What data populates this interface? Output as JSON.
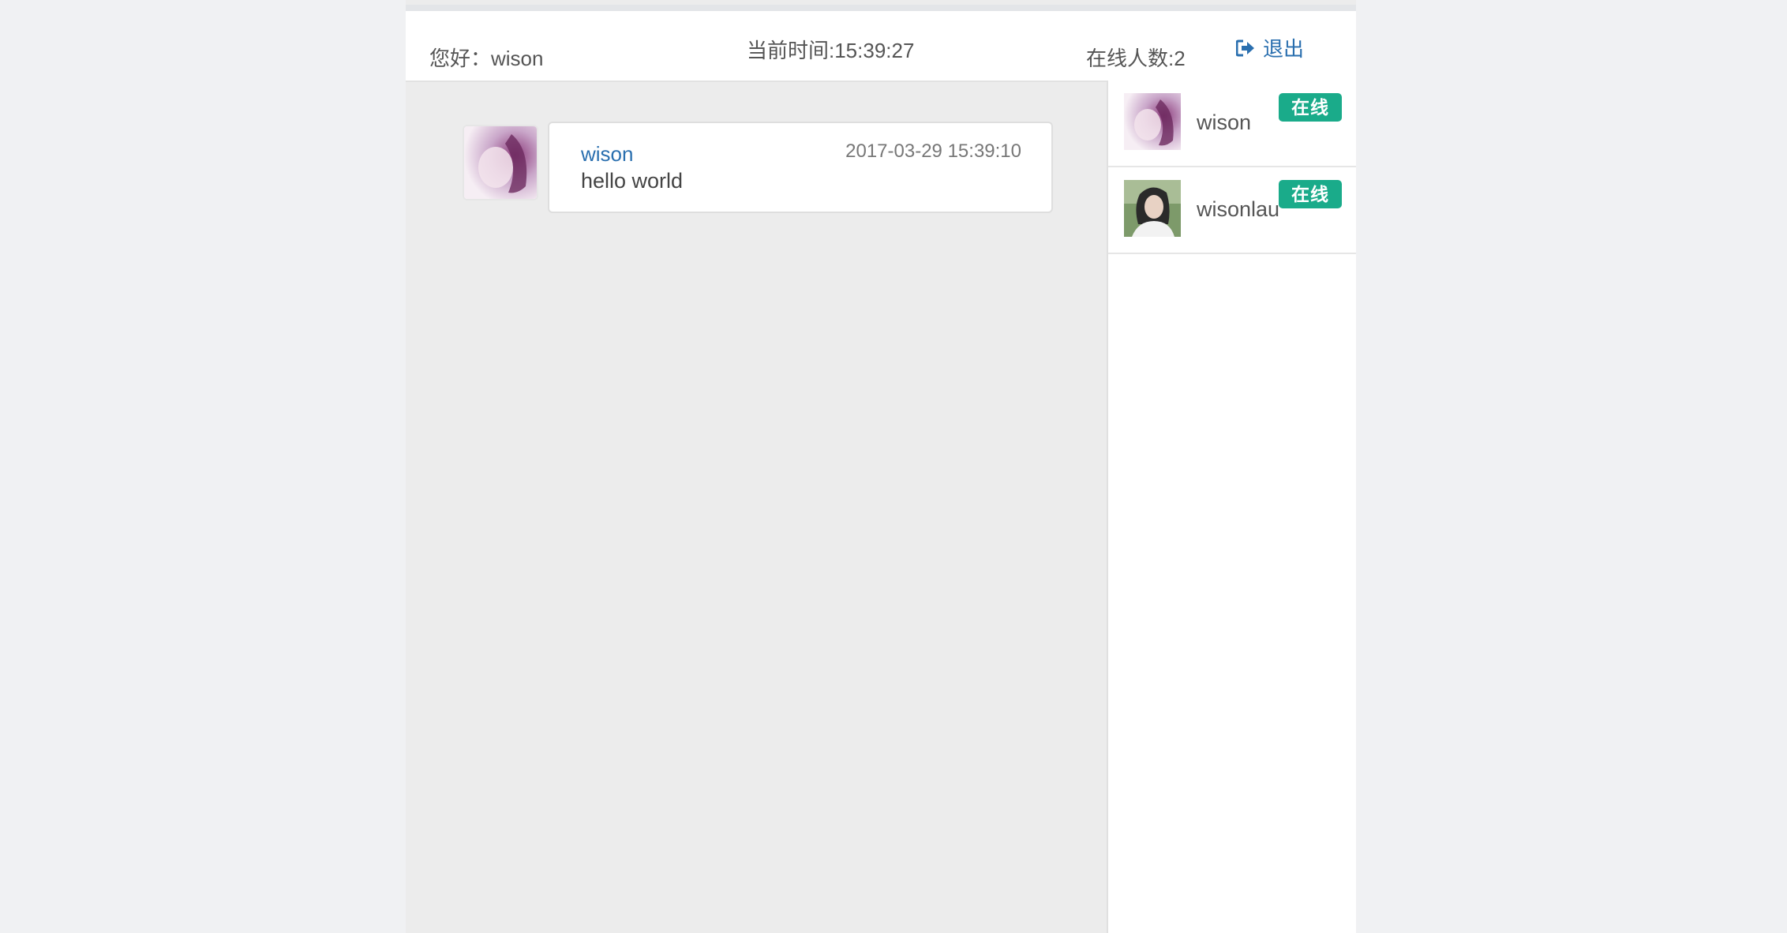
{
  "header": {
    "greeting": "您好：wison",
    "current_time": "当前时间:15:39:27",
    "online_count": "在线人数:2",
    "logout_label": "退出",
    "logout_icon": "sign-out-icon"
  },
  "messages": [
    {
      "user": "wison",
      "time": "2017-03-29 15:39:10",
      "text": "hello world"
    }
  ],
  "online_users": [
    {
      "name": "wison",
      "status": "在线"
    },
    {
      "name": "wisonlau",
      "status": "在线"
    }
  ],
  "colors": {
    "accent": "#2a6faf",
    "badge": "#1aab8a",
    "chat_bg": "#ececec"
  }
}
